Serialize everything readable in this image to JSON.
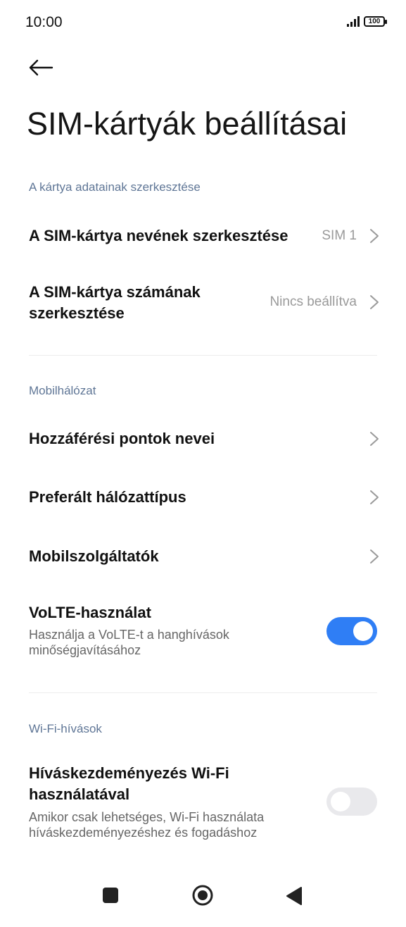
{
  "status": {
    "time": "10:00",
    "battery": "100"
  },
  "page": {
    "title": "SIM-kártyák beállításai"
  },
  "sections": {
    "card_edit": {
      "header": "A kártya adatainak szerkesztése",
      "sim_name": {
        "title": "A SIM-kártya nevének szerkesztése",
        "value": "SIM 1"
      },
      "sim_number": {
        "title_line1": "A SIM-kártya számának",
        "title_line2": "szerkesztése",
        "value": "Nincs beállítva"
      }
    },
    "mobile": {
      "header": "Mobilhálózat",
      "apn": {
        "title": "Hozzáférési pontok nevei"
      },
      "network_type": {
        "title": "Preferált hálózattípus"
      },
      "carriers": {
        "title": "Mobilszolgáltatók"
      },
      "volte": {
        "title": "VoLTE-használat",
        "sub_line1": "Használja a VoLTE-t a hanghívások",
        "sub_line2": "minőségjavításához",
        "enabled": true
      }
    },
    "wifi_calling": {
      "header": "Wi-Fi-hívások",
      "wifi_call": {
        "title_line1": "Híváskezdeményezés Wi-Fi",
        "title_line2": "használatával",
        "sub_line1": "Amikor csak lehetséges, Wi-Fi használata",
        "sub_line2": "híváskezdeményezéshez és fogadáshoz",
        "enabled": false
      }
    }
  },
  "colors": {
    "accent": "#2f7ef5",
    "section_header": "#5f7696"
  },
  "icons": [
    "back-arrow-icon",
    "chevron-right-icon",
    "signal-icon",
    "battery-icon",
    "recents-icon",
    "home-icon",
    "back-icon"
  ]
}
